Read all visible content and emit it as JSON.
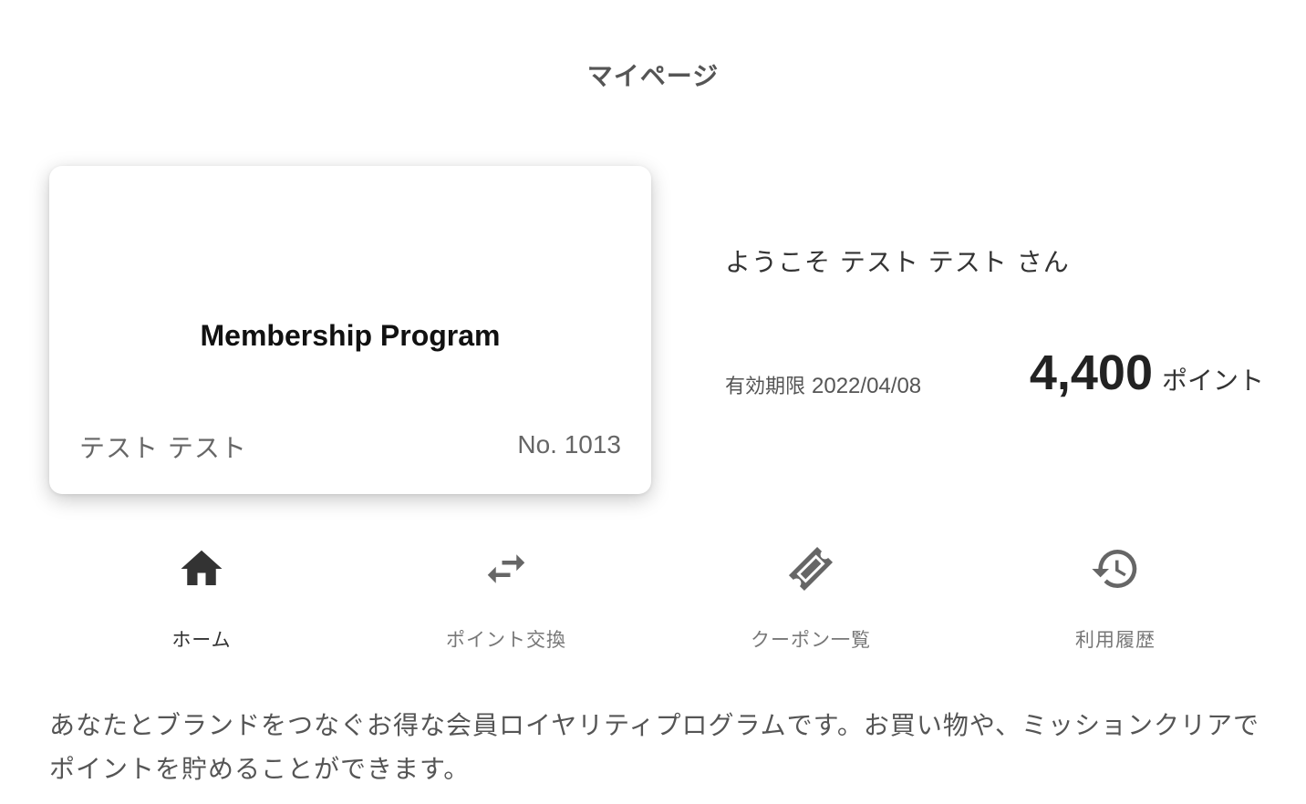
{
  "header": {
    "title": "マイページ"
  },
  "card": {
    "program_name": "Membership Program",
    "holder_name": "テスト テスト",
    "number": "No. 1013"
  },
  "account": {
    "welcome": "ようこそ テスト テスト さん",
    "expiry_label": "有効期限",
    "expiry_date": "2022/04/08",
    "points_value": "4,400",
    "points_unit": "ポイント"
  },
  "nav": {
    "items": [
      {
        "label": "ホーム",
        "icon": "home-icon",
        "active": true
      },
      {
        "label": "ポイント交換",
        "icon": "exchange-arrows-icon",
        "active": false
      },
      {
        "label": "クーポン一覧",
        "icon": "ticket-icon",
        "active": false
      },
      {
        "label": "利用履歴",
        "icon": "history-icon",
        "active": false
      }
    ]
  },
  "description": "あなたとブランドをつなぐお得な会員ロイヤリティプログラムです。お買い物や、ミッションクリアでポイントを貯めることができます。",
  "colors": {
    "active_icon": "#333333",
    "inactive_icon": "#666666",
    "text_muted": "#555555"
  }
}
